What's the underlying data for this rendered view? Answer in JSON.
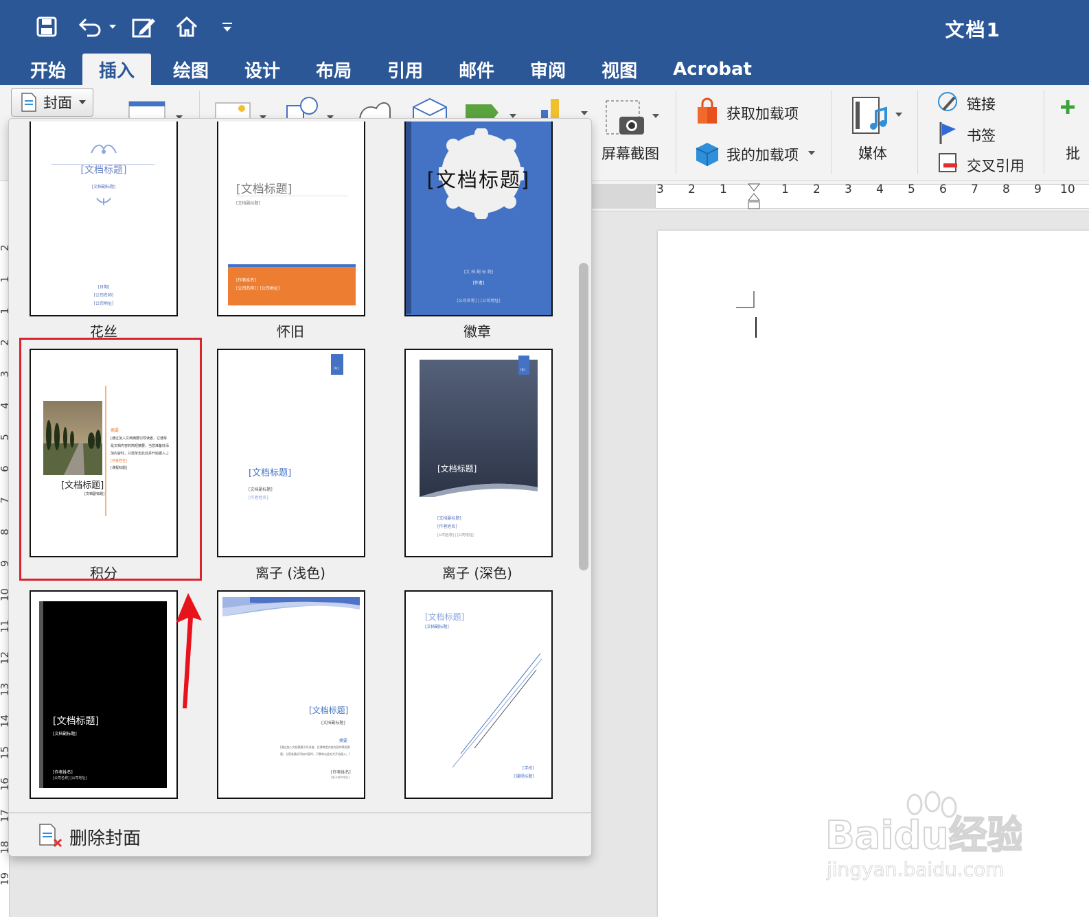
{
  "window": {
    "doc_title": "文档1"
  },
  "quick_access": [
    {
      "name": "save-icon",
      "glyph": "💾"
    },
    {
      "name": "undo-icon",
      "glyph": "↶"
    },
    {
      "name": "edit-icon",
      "glyph": "✎"
    },
    {
      "name": "home-icon",
      "glyph": "⌂"
    },
    {
      "name": "customize-dropdown-icon",
      "glyph": "▾"
    }
  ],
  "tabs": [
    "开始",
    "插入",
    "绘图",
    "设计",
    "布局",
    "引用",
    "邮件",
    "审阅",
    "视图",
    "Acrobat"
  ],
  "active_tab": "插入",
  "ribbon": {
    "cover_label": "封面",
    "screenshot_label": "屏幕截图",
    "get_addins_label": "获取加载项",
    "my_addins_label": "我的加载项",
    "media_label": "媒体",
    "link_label": "链接",
    "bookmark_label": "书签",
    "crossref_label": "交叉引用",
    "cut_label": "批"
  },
  "ruler": {
    "h_numbers": [
      "3",
      "2",
      "1",
      "1",
      "2",
      "3",
      "4",
      "5",
      "6",
      "7",
      "8",
      "9",
      "10"
    ],
    "v_numbers": [
      "2",
      "1",
      "1",
      "2",
      "3",
      "4",
      "5",
      "6",
      "7",
      "8",
      "9",
      "10",
      "11",
      "12",
      "13",
      "14",
      "15",
      "16",
      "17",
      "18",
      "19"
    ]
  },
  "gallery": {
    "items": [
      {
        "caption": "花丝",
        "title": "[文档标题]",
        "subtitle": "[文档副标题]",
        "footer1": "[日期]",
        "footer2": "[公司名称]",
        "footer3": "[公司地址]"
      },
      {
        "caption": "怀旧",
        "title": "[文档标题]",
        "subtitle": "[文档副标题]",
        "footer1": "[作者姓名]",
        "footer2": "[公司名称] | [公司地址]"
      },
      {
        "caption": "徽章",
        "title": "[文档标题]",
        "subtitle": "[文 档 副 标 题]",
        "footer1": "[作者]",
        "footer2": "[公司名称] | [公司地址]"
      },
      {
        "caption": "积分",
        "title": "[文档标题]",
        "subtitle": "[文档副标题]",
        "abstract_head": "摘要",
        "abstract": "[通过加入文档摘要引导读者，它通常是文档内容的简短摘要。当您准备好添加内容时，只需单击此处并开始键入。]",
        "author": "[作者姓名]",
        "course": "[课程标题]"
      },
      {
        "caption": "离子 (浅色)",
        "title": "[文档标题]",
        "subtitle": "[文档副标题]",
        "footer1": "[作者姓名]",
        "tag": "[年]"
      },
      {
        "caption": "离子 (深色)",
        "title": "[文档标题]",
        "subtitle": "[文档副标题]",
        "footer1": "[作者姓名]",
        "footer2": "[公司名称] | [公司地址]",
        "tag": "[年]"
      },
      {
        "caption": "",
        "title": "[文档标题]",
        "subtitle": "[文档副标题]",
        "footer1": "[作者姓名]",
        "footer2": "[公司名称] [公司地址]"
      },
      {
        "caption": "",
        "title": "[文档标题]",
        "subtitle": "[文档副标题]",
        "abstract_head": "摘要",
        "abstract": "[通过加入文档摘要引导读者，它通常是文档内容的简短摘要。当您准备好添加内容时，只需单击此处并开始键入。]",
        "author": "[作者姓名]",
        "footer2": "[电子邮件地址]"
      },
      {
        "caption": "",
        "title": "[文档标题]",
        "subtitle": "[文档副标题]",
        "footer1": "[学校]",
        "footer2": "[课程标题]"
      }
    ],
    "remove_label": "删除封面"
  },
  "watermark": {
    "text": "Baidu经验",
    "url": "jingyan.baidu.com"
  },
  "colors": {
    "titlebar": "#2b5797",
    "highlight": "#d9232e",
    "orange": "#ed7d31",
    "blue": "#4472c4"
  }
}
